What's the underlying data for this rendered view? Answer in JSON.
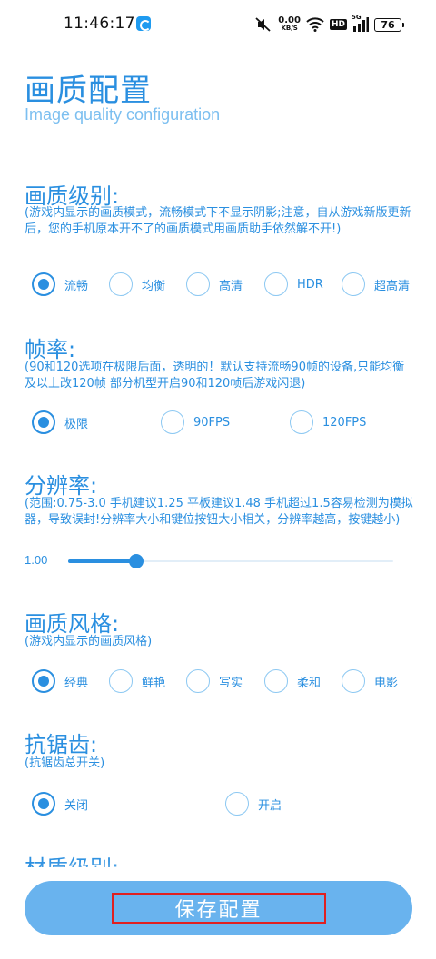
{
  "status_bar": {
    "time": "11:46:17",
    "net_speed_value": "0.00",
    "net_speed_unit": "KB/S",
    "hd_badge": "HD",
    "signal_label": "5G",
    "battery": "76"
  },
  "header": {
    "title": "画质配置",
    "subtitle": "Image quality configuration"
  },
  "sections": {
    "quality": {
      "heading": "画质级别:",
      "note": "(游戏内显示的画质模式，流畅模式下不显示阴影;注意，自从游戏新版更新后，您的手机原本开不了的画质模式用画质助手依然解不开!)",
      "options": [
        "流畅",
        "均衡",
        "高清",
        "HDR",
        "超高清"
      ],
      "selected": "流畅"
    },
    "framerate": {
      "heading": "帧率:",
      "note": "(90和120选项在极限后面，透明的！默认支持流畅90帧的设备,只能均衡及以上改120帧  部分机型开启90和120帧后游戏闪退)",
      "options": [
        "极限",
        "90FPS",
        "120FPS"
      ],
      "selected": "极限"
    },
    "resolution": {
      "heading": "分辨率:",
      "note": "(范围:0.75-3.0  手机建议1.25 平板建议1.48  手机超过1.5容易检测为模拟器，导致误封!分辨率大小和键位按钮大小相关，分辨率越高，按键越小)",
      "value_label": "1.00",
      "min": 0.75,
      "max": 3.0,
      "value": 1.0
    },
    "style": {
      "heading": "画质风格:",
      "note": "(游戏内显示的画质风格)",
      "options": [
        "经典",
        "鲜艳",
        "写实",
        "柔和",
        "电影"
      ],
      "selected": "经典"
    },
    "antialias": {
      "heading": "抗锯齿:",
      "note": "(抗锯齿总开关)",
      "options": [
        "关闭",
        "开启"
      ],
      "selected": "关闭"
    },
    "material": {
      "heading": "材质级别:"
    }
  },
  "footer": {
    "save_label": "保存配置"
  },
  "colors": {
    "accent": "#2a8fe0",
    "button": "#69b3ee",
    "highlight_box": "#e02020"
  }
}
